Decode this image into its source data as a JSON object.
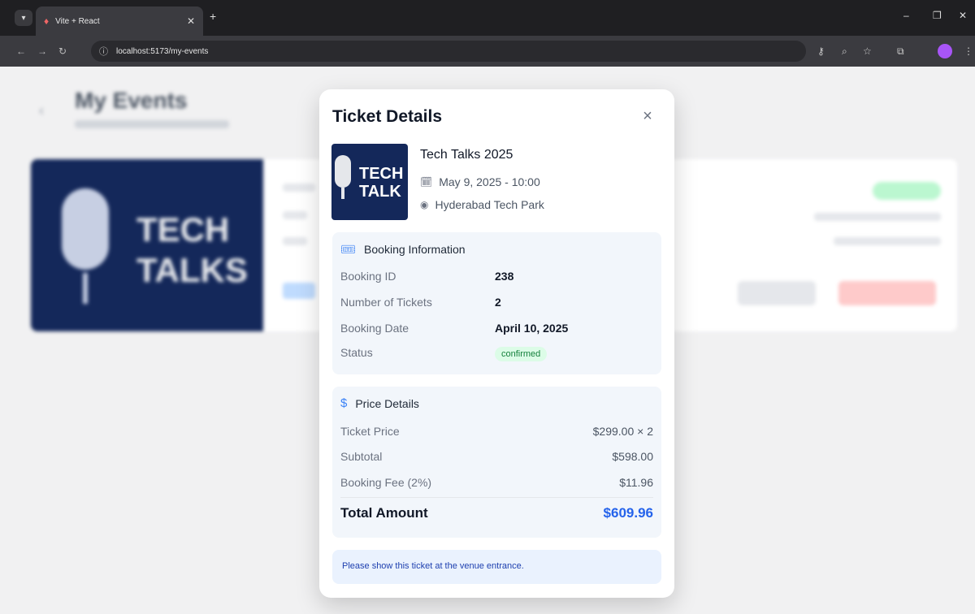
{
  "browser": {
    "tab_title": "Vite + React",
    "url": "localhost:5173/my-events"
  },
  "page": {
    "title": "My Events"
  },
  "background_card": {
    "image_text": "TECH\nTALKS"
  },
  "modal": {
    "title": "Ticket Details",
    "close_label": "×",
    "event": {
      "name": "Tech Talks 2025",
      "date_time": "May 9, 2025 - 10:00",
      "venue": "Hyderabad Tech Park",
      "thumb_text": "TECH\nTALK"
    },
    "booking": {
      "heading": "Booking Information",
      "rows": [
        {
          "label": "Booking ID",
          "value": "238"
        },
        {
          "label": "Number of Tickets",
          "value": "2"
        },
        {
          "label": "Booking Date",
          "value": "April 10, 2025"
        }
      ],
      "status_label": "Status",
      "status_value": "confirmed"
    },
    "price": {
      "heading": "Price Details",
      "rows": [
        {
          "label": "Ticket Price",
          "value": "$299.00 × 2"
        },
        {
          "label": "Subtotal",
          "value": "$598.00"
        },
        {
          "label": "Booking Fee (2%)",
          "value": "$11.96"
        }
      ],
      "total_label": "Total Amount",
      "total_value": "$609.96"
    },
    "note": "Please show this ticket at the venue entrance."
  },
  "colors": {
    "accent": "#2563eb",
    "status_bg": "#dcfce7",
    "status_text": "#15803d",
    "thumbnail_bg": "#14285a"
  },
  "icons": [
    "calendar-icon",
    "map-pin-icon",
    "ticket-icon",
    "dollar-icon",
    "close-icon",
    "back-arrow-icon"
  ]
}
